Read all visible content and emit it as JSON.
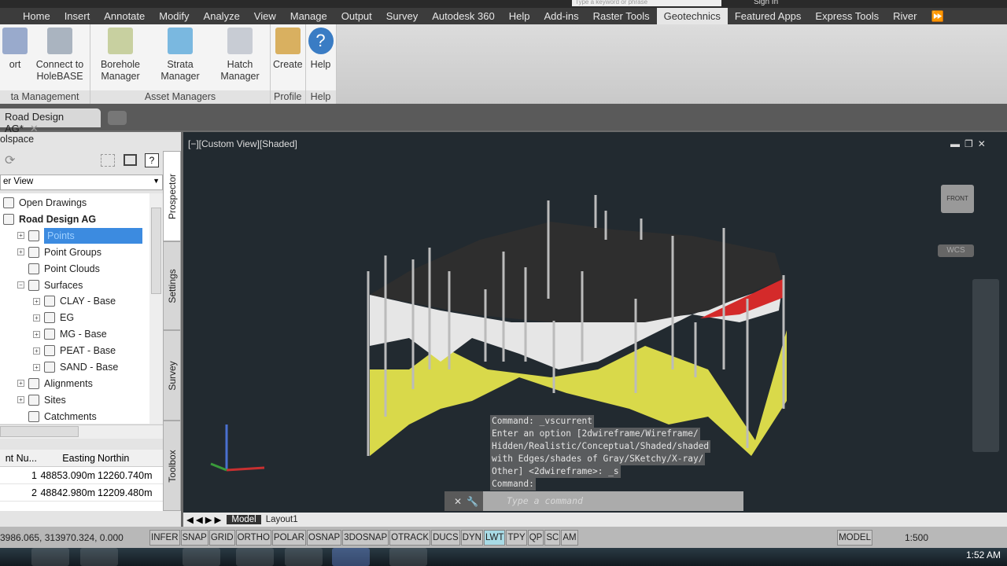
{
  "titlebar": {
    "search_placeholder": "Type a keyword or phrase",
    "sign_in": "Sign In"
  },
  "ribbon_tabs": [
    "Home",
    "Insert",
    "Annotate",
    "Modify",
    "Analyze",
    "View",
    "Manage",
    "Output",
    "Survey",
    "Autodesk 360",
    "Help",
    "Add-ins",
    "Raster Tools",
    "Geotechnics",
    "Featured Apps",
    "Express Tools",
    "River"
  ],
  "active_ribbon_tab": "Geotechnics",
  "panels": [
    {
      "title": "ta Management",
      "buttons": [
        {
          "label": "ort",
          "icon": "import-icon"
        },
        {
          "label": "Connect to HoleBASE",
          "icon": "database-connect-icon"
        }
      ]
    },
    {
      "title": "Asset Managers",
      "buttons": [
        {
          "label": "Borehole Manager",
          "icon": "borehole-icon"
        },
        {
          "label": "Strata Manager",
          "icon": "strata-icon"
        },
        {
          "label": "Hatch Manager",
          "icon": "hatch-icon"
        }
      ]
    },
    {
      "title": "Profile",
      "buttons": [
        {
          "label": "Create",
          "icon": "profile-create-icon"
        }
      ]
    },
    {
      "title": "Help",
      "buttons": [
        {
          "label": "Help",
          "icon": "help-icon"
        }
      ]
    }
  ],
  "document_tab": {
    "label": "Road Design AG*"
  },
  "toolspace": {
    "title": "olspace",
    "view_select": "er View",
    "tree": [
      {
        "label": "Open Drawings",
        "level": 0
      },
      {
        "label": "Road Design AG",
        "level": 1,
        "bold": true
      },
      {
        "label": "Points",
        "level": 2,
        "selected": true
      },
      {
        "label": "Point Groups",
        "level": 2
      },
      {
        "label": "Point Clouds",
        "level": 2
      },
      {
        "label": "Surfaces",
        "level": 2
      },
      {
        "label": "CLAY - Base",
        "level": 3
      },
      {
        "label": "EG",
        "level": 3
      },
      {
        "label": "MG - Base",
        "level": 3
      },
      {
        "label": "PEAT - Base",
        "level": 3
      },
      {
        "label": "SAND - Base",
        "level": 3
      },
      {
        "label": "Alignments",
        "level": 2
      },
      {
        "label": "Sites",
        "level": 2
      },
      {
        "label": "Catchments",
        "level": 2
      }
    ],
    "side_tabs": [
      "Prospector",
      "Settings",
      "Survey",
      "Toolbox"
    ],
    "table": {
      "headers": [
        "nt Nu...",
        "Easting",
        "Northin"
      ],
      "rows": [
        [
          "1",
          "48853.090m",
          "12260.740m"
        ],
        [
          "2",
          "48842.980m",
          "12209.480m"
        ]
      ]
    }
  },
  "viewport": {
    "label": "[−][Custom View][Shaded]",
    "wcs": "WCS",
    "viewcube": "FRONT"
  },
  "command": {
    "history": [
      "Command: _vscurrent",
      "Enter an option [2dwireframe/Wireframe/",
      "Hidden/Realistic/Conceptual/Shaded/shaded",
      "with Edges/shades of Gray/SKetchy/X-ray/",
      "Other] <2dwireframe>: _s",
      "Command:"
    ],
    "placeholder": "Type a command"
  },
  "layout_tabs": [
    "Model",
    "Layout1"
  ],
  "statusbar": {
    "coords": "3986.065, 313970.324, 0.000",
    "toggles": [
      "INFER",
      "SNAP",
      "GRID",
      "ORTHO",
      "POLAR",
      "OSNAP",
      "3DOSNAP",
      "OTRACK",
      "DUCS",
      "DYN",
      "LWT",
      "TPY",
      "QP",
      "SC",
      "AM"
    ],
    "active_toggle": "LWT",
    "model": "MODEL",
    "scale": "1:500"
  },
  "taskbar": {
    "clock": "1:52 AM"
  }
}
